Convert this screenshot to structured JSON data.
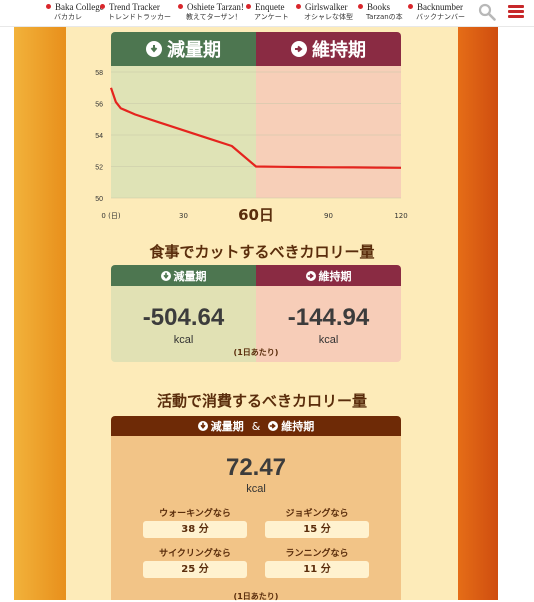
{
  "nav": {
    "items": [
      {
        "en": "Baka College",
        "jp": "バカカレ"
      },
      {
        "en": "Trend Tracker",
        "jp": "トレンドトラッカー"
      },
      {
        "en": "Oshiete Tarzan!",
        "jp": "教えてターザン！"
      },
      {
        "en": "Enquete",
        "jp": "アンケート"
      },
      {
        "en": "Girlswalker",
        "jp": "オシャレな体型"
      },
      {
        "en": "Books",
        "jp": "Tarzanの本"
      },
      {
        "en": "Backnumber",
        "jp": "バックナンバー"
      }
    ],
    "search_icon": "search-icon",
    "menu_icon": "hamburger-menu-icon"
  },
  "phases": {
    "lose": "減量期",
    "keep": "維持期"
  },
  "chart_data": {
    "type": "line",
    "x": [
      0,
      2,
      4,
      10,
      20,
      30,
      40,
      50,
      60,
      70,
      80,
      90,
      100,
      110,
      120
    ],
    "series": [
      {
        "values": [
          57.0,
          56.1,
          55.7,
          55.3,
          54.8,
          54.3,
          53.8,
          53.3,
          52.0,
          51.98,
          51.96,
          51.95,
          51.94,
          51.93,
          51.92
        ]
      }
    ],
    "xticks": [
      "0 (日)",
      "30",
      "60日",
      "90",
      "120"
    ],
    "yticks": [
      "58",
      "56",
      "54",
      "52",
      "50"
    ],
    "xlim": [
      0,
      120
    ],
    "ylim": [
      50,
      58
    ],
    "phase_split_x": 60,
    "grid": true,
    "colors": {
      "line": "#e5241e",
      "lose_bg": "#dfe3b6",
      "keep_bg": "#f7cfb8",
      "grid": "#c8c8a8"
    }
  },
  "cut": {
    "title": "食事でカットするべきカロリー量",
    "lose_label": "減量期",
    "keep_label": "維持期",
    "lose_value": "-504.64",
    "keep_value": "-144.94",
    "unit": "kcal",
    "per_day": "(1日あたり)"
  },
  "activity": {
    "title": "活動で消費するべきカロリー量",
    "head_lose": "減量期",
    "head_amp": "&",
    "head_keep": "維持期",
    "value": "72.47",
    "unit": "kcal",
    "items": [
      {
        "label": "ウォーキングなら",
        "value": "38 分"
      },
      {
        "label": "ジョギングなら",
        "value": "15 分"
      },
      {
        "label": "サイクリングなら",
        "value": "25 分"
      },
      {
        "label": "ランニングなら",
        "value": "11 分"
      }
    ],
    "per_day": "(1日あたり)"
  },
  "colors": {
    "lose": "#4d7650",
    "keep": "#8a2b43",
    "accent": "#c7282a"
  }
}
